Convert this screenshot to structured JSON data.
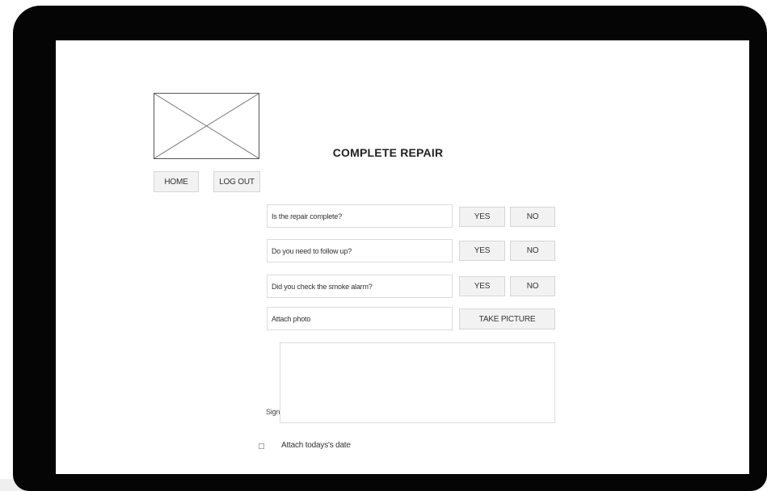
{
  "page": {
    "title": "COMPLETE REPAIR"
  },
  "nav": {
    "home_label": "HOME",
    "logout_label": "LOG OUT"
  },
  "questions": [
    {
      "text": "Is the repair complete?",
      "yes_label": "YES",
      "no_label": "NO"
    },
    {
      "text": "Do you need to follow up?",
      "yes_label": "YES",
      "no_label": "NO"
    },
    {
      "text": "Did you check the smoke alarm?",
      "yes_label": "YES",
      "no_label": "NO"
    }
  ],
  "photo": {
    "label": "Attach photo",
    "button_label": "TAKE PICTURE"
  },
  "signature": {
    "label": "Sign:"
  },
  "date_option": {
    "label": "Attach todays's date",
    "checked": false
  },
  "icons": {
    "logo": "image-placeholder-icon"
  },
  "colors": {
    "device_frame": "#050505",
    "screen": "#ffffff",
    "button_bg": "#f2f2f2",
    "border": "#dcdcdc"
  }
}
